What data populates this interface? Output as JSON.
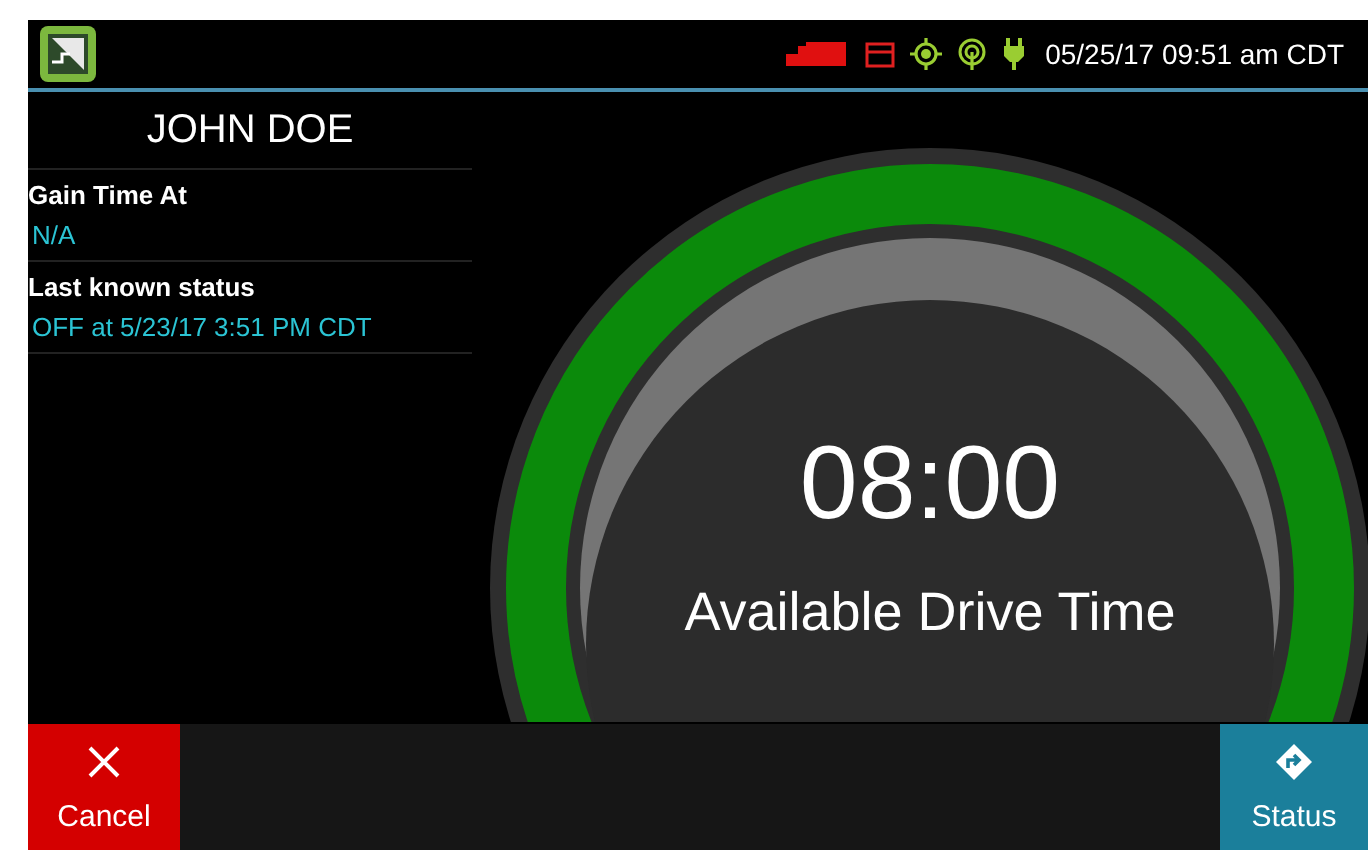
{
  "status_bar": {
    "datetime": "05/25/17 09:51 am CDT"
  },
  "driver": {
    "name": "JOHN DOE"
  },
  "fields": [
    {
      "label": "Gain Time At",
      "value": "N/A"
    },
    {
      "label": "Last known status",
      "value": "OFF at 5/23/17 3:51 PM CDT"
    }
  ],
  "gauge": {
    "time": "08:00",
    "caption": "Available Drive Time"
  },
  "buttons": [
    {
      "label": "Cancel",
      "kind": "cancel"
    },
    {
      "label": "Status",
      "kind": "status"
    }
  ]
}
